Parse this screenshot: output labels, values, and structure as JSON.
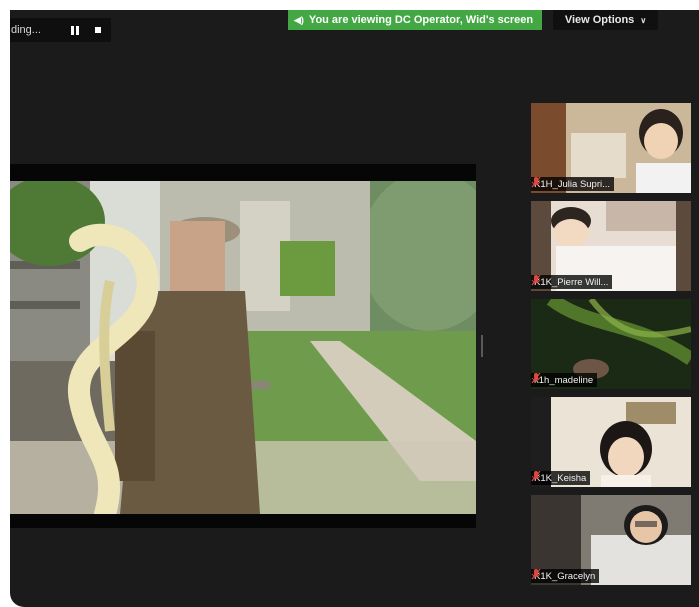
{
  "recording": {
    "status_text": "ding...",
    "pause_icon": "pause-icon",
    "stop_icon": "stop-icon"
  },
  "banner": {
    "text": "You are viewing DC Operator, Wid's screen",
    "icon": "speaker-icon",
    "color": "#43a844"
  },
  "view_options": {
    "label": "View Options",
    "icon": "chevron-down-icon"
  },
  "participants": [
    {
      "name": "K1H_Julia Supri..."
    },
    {
      "name": "K1K_Pierre Will..."
    },
    {
      "name": "k1h_madeline"
    },
    {
      "name": "K1K_Keisha"
    },
    {
      "name": "K1K_Gracelyn"
    }
  ],
  "colors": {
    "background": "#1b1b1b",
    "muted_mic": "#e0463f"
  }
}
